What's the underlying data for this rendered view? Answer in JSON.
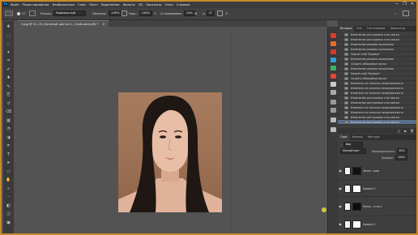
{
  "menu": {
    "app_badge": "Ps",
    "items": [
      "Файл",
      "Редактирование",
      "Изображение",
      "Слои",
      "Текст",
      "Выделение",
      "Фильтр",
      "3D",
      "Просмотр",
      "Окно",
      "Справка"
    ],
    "window_buttons": [
      "—",
      "❐",
      "✕"
    ]
  },
  "options": {
    "size": "27",
    "mode_label": "Режим:",
    "mode_value": "Нормальный",
    "opacity_label": "Непрозр.:",
    "opacity_value": "100%",
    "pressure_label": "Наж.:",
    "pressure_value": "100%",
    "smoothing_label": "Сглаживание:",
    "smoothing_value": "10%",
    "angle_value": "0°"
  },
  "document": {
    "tab_label": "5.jpg @ 51,1% (Зеленый цветки 1, Слой-маска/8) *"
  },
  "toolbar": {
    "tools": [
      "move-tool",
      "marquee-tool",
      "lasso-tool",
      "quick-select-tool",
      "crop-tool",
      "eyedropper-tool",
      "healing-tool",
      "brush-tool",
      "stamp-tool",
      "history-brush-tool",
      "eraser-tool",
      "gradient-tool",
      "blur-tool",
      "dodge-tool",
      "pen-tool",
      "type-tool",
      "path-select-tool",
      "shape-tool",
      "hand-tool",
      "zoom-tool",
      "edit-toolbar",
      "fg-bg-colors",
      "quick-mask",
      "screen-mode"
    ]
  },
  "history_panel": {
    "tabs": [
      "История",
      "Info",
      "Гистограмма",
      "Навигатор"
    ],
    "active_tab": "История",
    "items": [
      "Изменение растушевки стоп-маски",
      "Изменение растушевки стоп-маски",
      "Изменение режима наложения",
      "Изменение режима наложения",
      "Новый слой \"Кривые\"",
      "Изменение режима наложения",
      "Создать абзацевые маски",
      "Изменение режима наложения",
      "Новый слой \"Кривые\"",
      "Создать абзацевые маски",
      "Изменить не сильную непрозрачность",
      "Изменить не сильную непрозрачность",
      "Изменить не сильную непрозрачность",
      "Изменение растушевки стоп-маски",
      "Изменение растушевки стоп-маски",
      "Изменить не сильную непрозрачность",
      "Изменить не сильную непрозрачность",
      "Изменение растушевки стоп-маски",
      "Изменение растушевки стоп-маски"
    ],
    "selected_index": 18
  },
  "layers_panel": {
    "tabs": [
      "Слои",
      "Каналы",
      "Контуры"
    ],
    "active_tab": "Слои",
    "filter_label": "Вид",
    "blend_mode": "Мягкий свет",
    "opacity_label": "Непрозрачность:",
    "opacity_value": "61%",
    "fill_label": "Заливка:",
    "fill_value": "100%",
    "layers": [
      {
        "name": "Зелен...ыми",
        "kind": "mask-light"
      },
      {
        "name": "Кривые 2",
        "kind": "white"
      },
      {
        "name": "Зелен...стки 1",
        "kind": "mask-dark"
      },
      {
        "name": "Кривые 1",
        "kind": "white"
      }
    ]
  },
  "colors": {
    "frame_border": "#c98a2c",
    "selection": "#5a6f8c"
  }
}
